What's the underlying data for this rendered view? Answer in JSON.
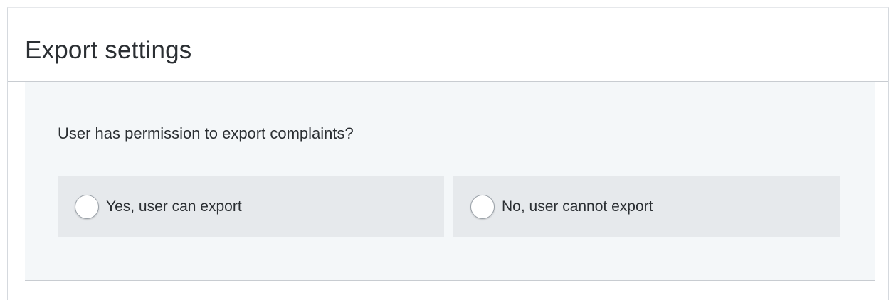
{
  "panel": {
    "title": "Export settings"
  },
  "export_permission": {
    "question": "User has permission to export complaints?",
    "options": [
      {
        "label": "Yes, user can export",
        "selected": false
      },
      {
        "label": "No, user cannot export",
        "selected": false
      }
    ]
  },
  "colors": {
    "content_background": "#f4f7f9",
    "option_background": "#e6e9ec",
    "text": "#2b2f33",
    "divider": "#c8ccd1"
  }
}
